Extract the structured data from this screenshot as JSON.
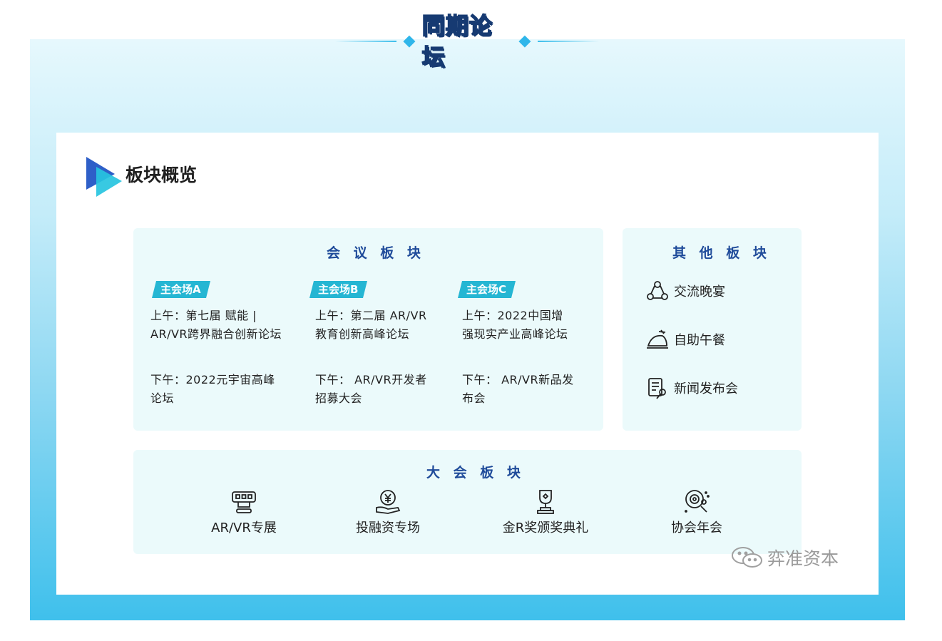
{
  "header": {
    "title": "同期论坛"
  },
  "card": {
    "title": "板块概览"
  },
  "conference": {
    "title": "会 议 板 块",
    "venues": [
      {
        "tag": "主会场A",
        "morning_l1": "上午：第七届  赋能  |",
        "morning_l2": "AR/VR跨界融合创新论坛",
        "afternoon_l1": "下午：2022元宇宙高峰",
        "afternoon_l2": "论坛"
      },
      {
        "tag": "主会场B",
        "morning_l1": "上午：第二届 AR/VR",
        "morning_l2": "教育创新高峰论坛",
        "afternoon_l1": "下午： AR/VR开发者",
        "afternoon_l2": "招募大会"
      },
      {
        "tag": "主会场C",
        "morning_l1": "上午：2022中国增",
        "morning_l2": "强现实产业高峰论坛",
        "afternoon_l1": "下午： AR/VR新品发",
        "afternoon_l2": "布会"
      }
    ]
  },
  "other": {
    "title": "其 他 板 块",
    "items": [
      {
        "label": "交流晚宴",
        "icon": "dinner-icon"
      },
      {
        "label": "自助午餐",
        "icon": "lunch-icon"
      },
      {
        "label": "新闻发布会",
        "icon": "press-icon"
      }
    ]
  },
  "main": {
    "title": "大 会 板 块",
    "items": [
      {
        "label": "AR/VR专展",
        "icon": "vr-headset-icon"
      },
      {
        "label": "投融资专场",
        "icon": "investment-icon"
      },
      {
        "label": "金R奖颁奖典礼",
        "icon": "trophy-icon"
      },
      {
        "label": "协会年会",
        "icon": "meeting-icon"
      }
    ]
  },
  "watermark": {
    "text": "弈准资本"
  },
  "colors": {
    "accent": "#25b6d3",
    "title_blue": "#1f4b9a",
    "panel_bg": "#ebfafb",
    "outer_bottom": "#3fc0ec"
  }
}
